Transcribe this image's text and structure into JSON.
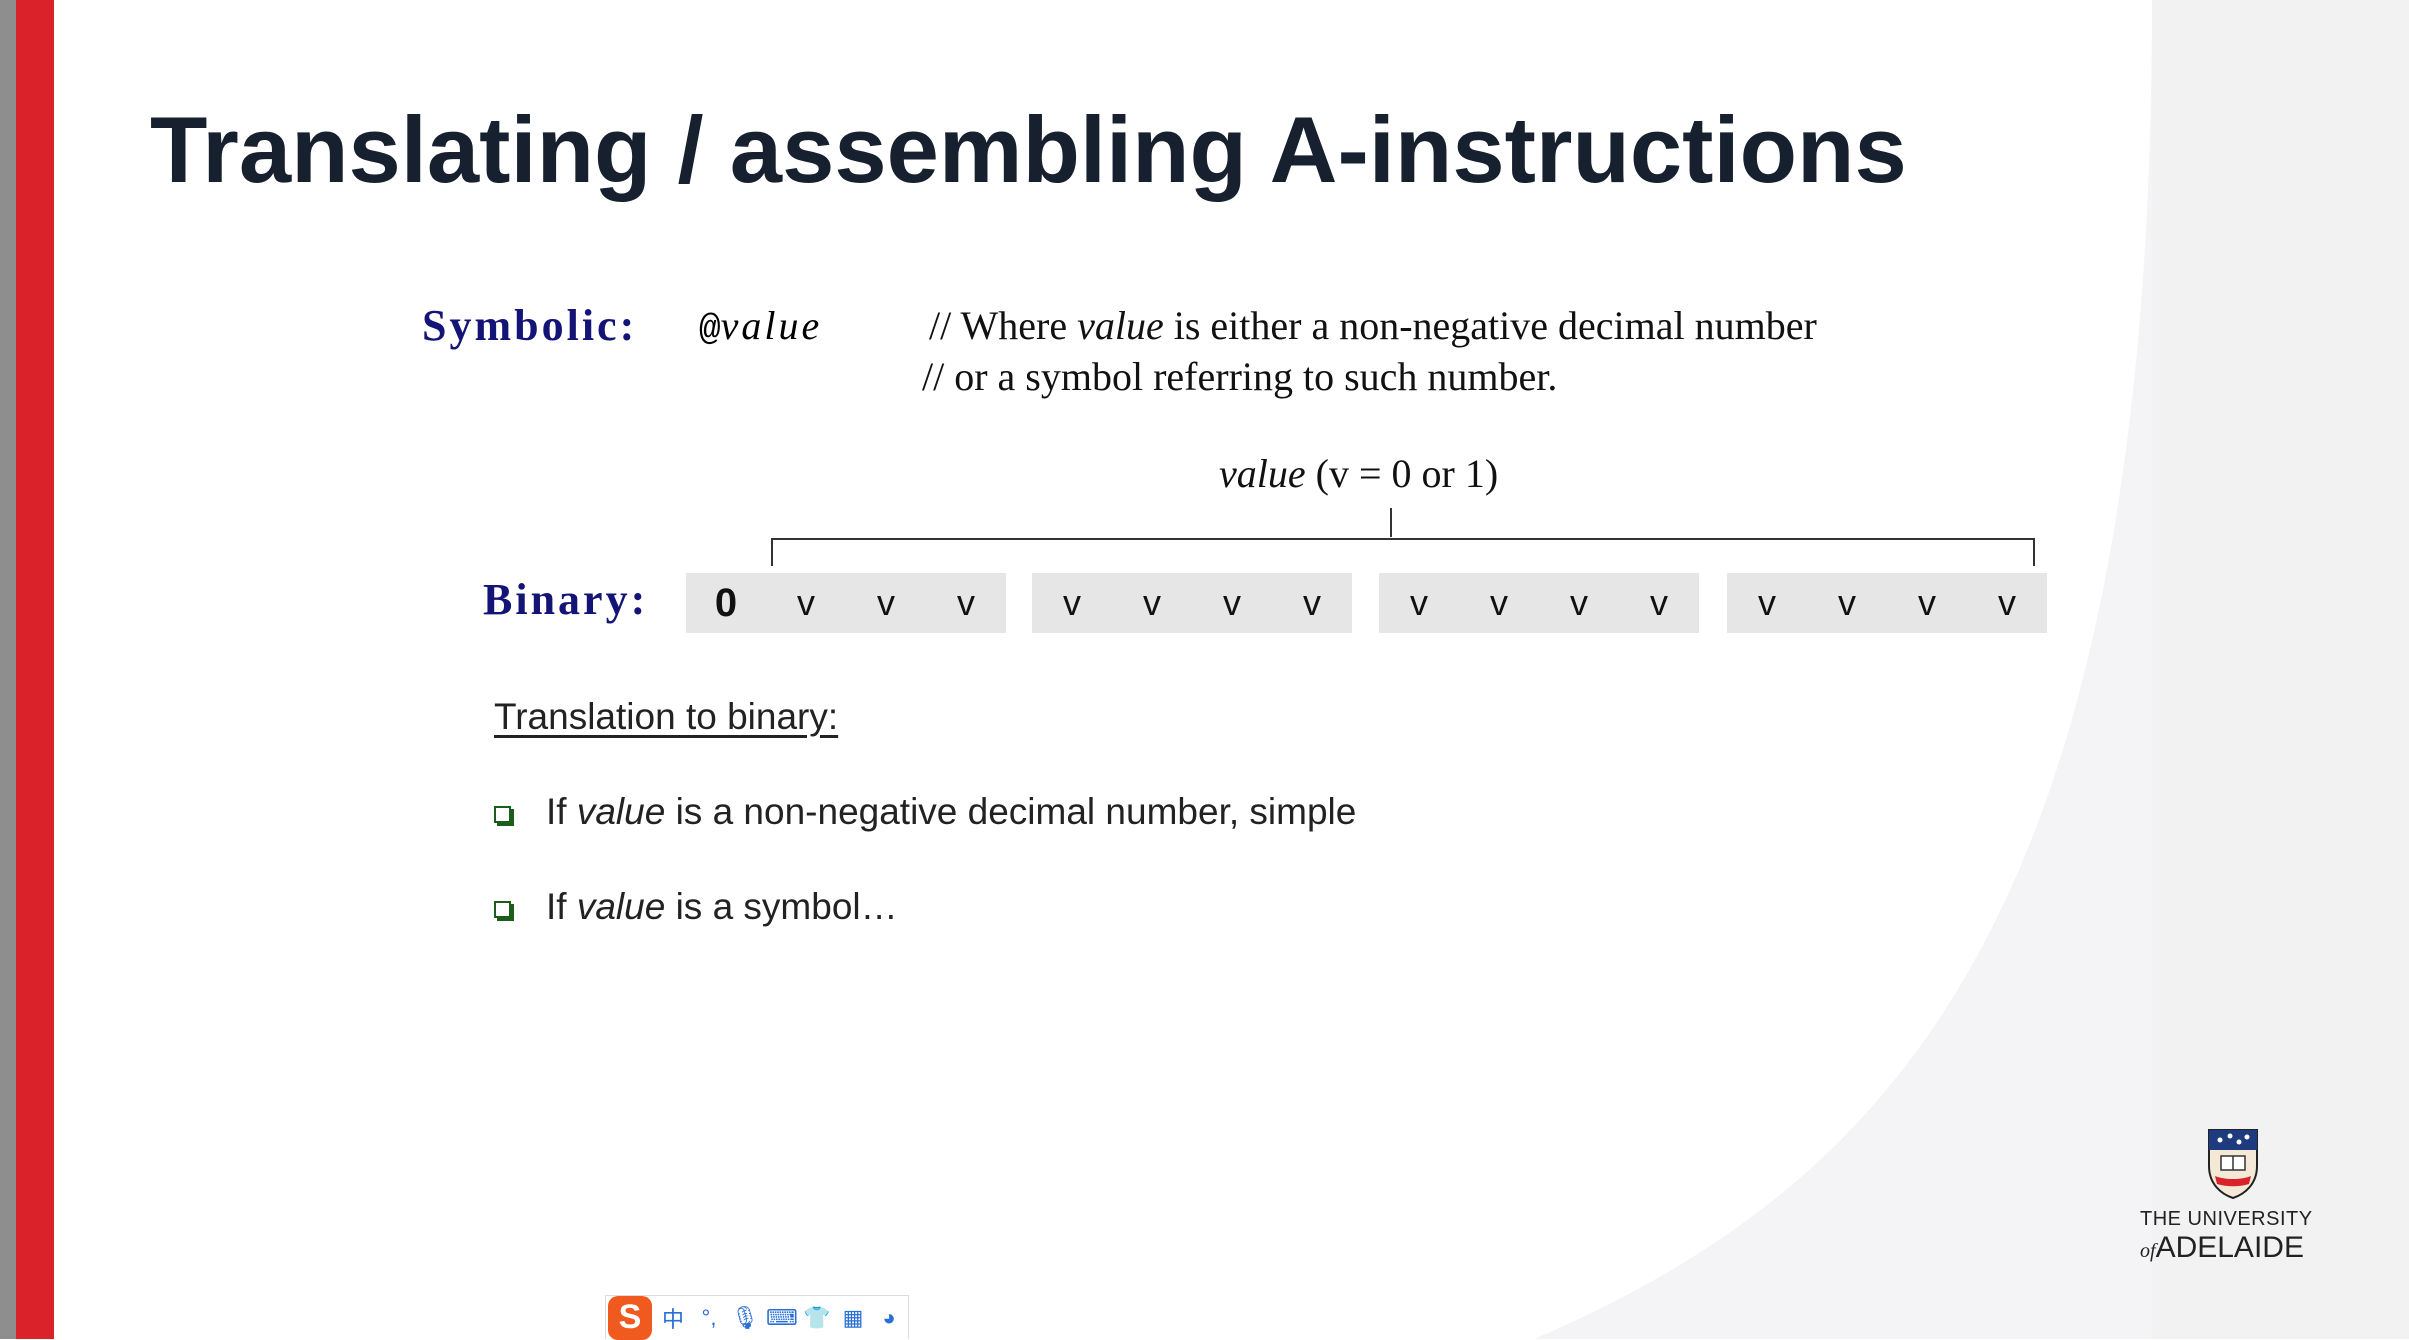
{
  "slide": {
    "title": "Translating / assembling A-instructions",
    "symbolic": {
      "label": "Symbolic:",
      "at": "@",
      "value": "value",
      "comment_line1_prefix": "// Where ",
      "comment_line1_italic": "value",
      "comment_line1_suffix": " is either a non-negative decimal number",
      "comment_line2": "//  or a symbol referring to such number."
    },
    "value_range": {
      "italic": "value",
      "rest": " (v = 0 or 1)"
    },
    "binary": {
      "label": "Binary:",
      "groups": [
        [
          "0",
          "v",
          "v",
          "v"
        ],
        [
          "v",
          "v",
          "v",
          "v"
        ],
        [
          "v",
          "v",
          "v",
          "v"
        ],
        [
          "v",
          "v",
          "v",
          "v"
        ]
      ]
    },
    "translation_heading": "Translation to binary:",
    "bullets": [
      {
        "prefix": "If ",
        "italic": "value",
        "suffix": " is a non-negative decimal number, simple"
      },
      {
        "prefix": "If ",
        "italic": "value",
        "suffix": " is a symbol…"
      }
    ]
  },
  "logo": {
    "line1": "THE UNIVERSITY",
    "line2_of": "of",
    "line2_name": "ADELAIDE"
  },
  "ime_toolbar": {
    "logo": "S",
    "buttons": [
      {
        "icon": "chinese-mode-icon",
        "glyph": "中"
      },
      {
        "icon": "punctuation-icon",
        "glyph": "°,"
      },
      {
        "icon": "microphone-icon",
        "glyph": "🎙"
      },
      {
        "icon": "keyboard-icon",
        "glyph": "⌨"
      },
      {
        "icon": "skin-icon",
        "glyph": "👕"
      },
      {
        "icon": "apps-icon",
        "glyph": "▦"
      },
      {
        "icon": "mascot-icon",
        "glyph": "◕"
      }
    ],
    "accent_color": "#f05a1e"
  },
  "colors": {
    "red_bar": "#d9222a",
    "label_blue": "#141476",
    "title": "#17202e",
    "bit_box": "#e6e6e6",
    "bullet_green": "#1a5e1a"
  }
}
